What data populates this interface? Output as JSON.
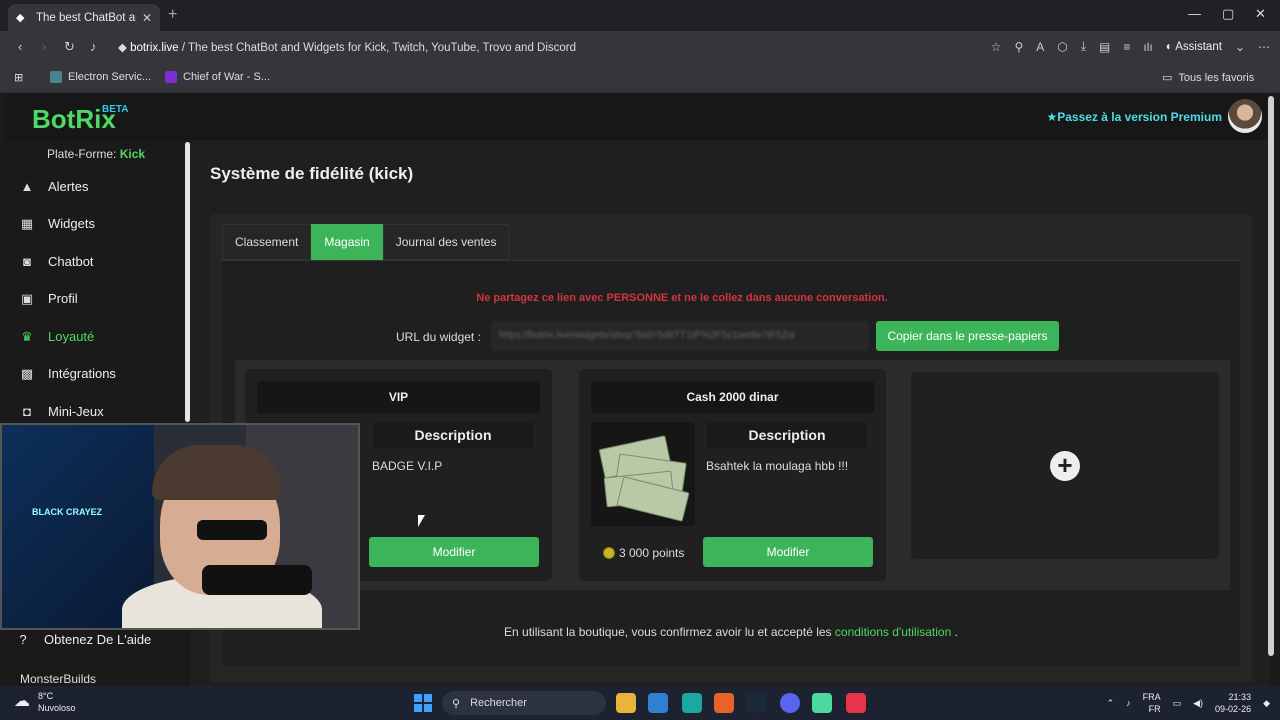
{
  "browser": {
    "tab_title": "The best ChatBot and Wi",
    "url_domain": "botrix.live",
    "url_rest": " / The best ChatBot and Widgets for Kick, Twitch, YouTube, Trovo and Discord",
    "assistant_label": "Assistant",
    "bookmarks": [
      "Electron Servic...",
      "Chief of War - S..."
    ],
    "favorites_label": "Tous les favoris"
  },
  "app": {
    "logo": "BotRix",
    "logo_badge": "BETA",
    "premium_label": "Passez à la version Premium",
    "platform_label": "Plate-Forme:",
    "platform_value": "Kick"
  },
  "sidebar": {
    "items": [
      {
        "label": "Alertes",
        "icon": "warning-icon"
      },
      {
        "label": "Widgets",
        "icon": "grid-icon"
      },
      {
        "label": "Chatbot",
        "icon": "robot-icon"
      },
      {
        "label": "Profil",
        "icon": "id-card-icon"
      },
      {
        "label": "Loyauté",
        "icon": "trophy-icon",
        "active": true
      },
      {
        "label": "Intégrations",
        "icon": "puzzle-icon"
      },
      {
        "label": "Mini-Jeux",
        "icon": "gamepad-icon"
      }
    ],
    "help_label": "Obtenez De L'aide",
    "partial_item": "MonsterBuilds"
  },
  "page": {
    "title": "Système de fidélité (kick)",
    "tabs": [
      "Classement",
      "Magasin",
      "Journal des ventes"
    ],
    "active_tab": "Magasin",
    "warning": "Ne partagez ce lien avec PERSONNE et ne le collez dans aucune conversation.",
    "url_label": "URL du widget :",
    "url_value": "https://botrix.live/widgets/shop?bid=5d8TT1IP%2F5z1we8e7tF5Zw",
    "copy_button": "Copier dans le presse-papiers",
    "terms_prefix": "En utilisant la boutique, vous confirmez avoir lu et accepté les",
    "terms_link": "conditions d'utilisation",
    "terms_suffix": "."
  },
  "cards": [
    {
      "title": "VIP",
      "desc_title": "Description",
      "description": "BADGE V.I.P",
      "button": "Modifier"
    },
    {
      "title": "Cash 2000 dinar",
      "desc_title": "Description",
      "description": "Bsahtek la moulaga hbb !!!",
      "price": "3 000 points",
      "button": "Modifier"
    }
  ],
  "webcam": {
    "neon_text": "BLACK CRAYEZ"
  },
  "taskbar": {
    "temp": "8°C",
    "weather": "Nuvoloso",
    "search": "Rechercher",
    "lang1": "FRA",
    "lang2": "FR",
    "time": "21:33",
    "date": "09-02-26"
  },
  "colors": {
    "accent": "#3cb55a",
    "brand": "#4cd964",
    "warning": "#d3343e",
    "premium": "#4fdce8"
  }
}
